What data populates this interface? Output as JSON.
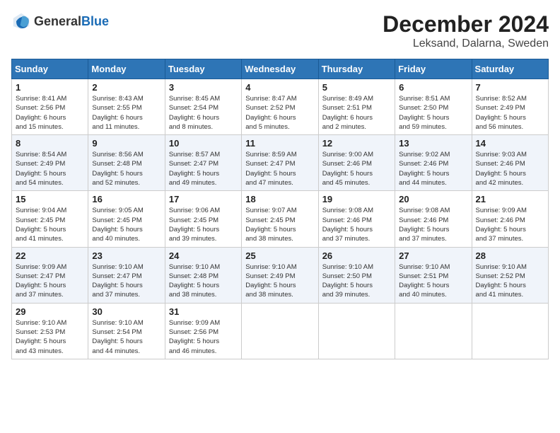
{
  "logo": {
    "general": "General",
    "blue": "Blue"
  },
  "header": {
    "month": "December 2024",
    "location": "Leksand, Dalarna, Sweden"
  },
  "weekdays": [
    "Sunday",
    "Monday",
    "Tuesday",
    "Wednesday",
    "Thursday",
    "Friday",
    "Saturday"
  ],
  "weeks": [
    [
      {
        "day": "1",
        "info": "Sunrise: 8:41 AM\nSunset: 2:56 PM\nDaylight: 6 hours\nand 15 minutes."
      },
      {
        "day": "2",
        "info": "Sunrise: 8:43 AM\nSunset: 2:55 PM\nDaylight: 6 hours\nand 11 minutes."
      },
      {
        "day": "3",
        "info": "Sunrise: 8:45 AM\nSunset: 2:54 PM\nDaylight: 6 hours\nand 8 minutes."
      },
      {
        "day": "4",
        "info": "Sunrise: 8:47 AM\nSunset: 2:52 PM\nDaylight: 6 hours\nand 5 minutes."
      },
      {
        "day": "5",
        "info": "Sunrise: 8:49 AM\nSunset: 2:51 PM\nDaylight: 6 hours\nand 2 minutes."
      },
      {
        "day": "6",
        "info": "Sunrise: 8:51 AM\nSunset: 2:50 PM\nDaylight: 5 hours\nand 59 minutes."
      },
      {
        "day": "7",
        "info": "Sunrise: 8:52 AM\nSunset: 2:49 PM\nDaylight: 5 hours\nand 56 minutes."
      }
    ],
    [
      {
        "day": "8",
        "info": "Sunrise: 8:54 AM\nSunset: 2:49 PM\nDaylight: 5 hours\nand 54 minutes."
      },
      {
        "day": "9",
        "info": "Sunrise: 8:56 AM\nSunset: 2:48 PM\nDaylight: 5 hours\nand 52 minutes."
      },
      {
        "day": "10",
        "info": "Sunrise: 8:57 AM\nSunset: 2:47 PM\nDaylight: 5 hours\nand 49 minutes."
      },
      {
        "day": "11",
        "info": "Sunrise: 8:59 AM\nSunset: 2:47 PM\nDaylight: 5 hours\nand 47 minutes."
      },
      {
        "day": "12",
        "info": "Sunrise: 9:00 AM\nSunset: 2:46 PM\nDaylight: 5 hours\nand 45 minutes."
      },
      {
        "day": "13",
        "info": "Sunrise: 9:02 AM\nSunset: 2:46 PM\nDaylight: 5 hours\nand 44 minutes."
      },
      {
        "day": "14",
        "info": "Sunrise: 9:03 AM\nSunset: 2:46 PM\nDaylight: 5 hours\nand 42 minutes."
      }
    ],
    [
      {
        "day": "15",
        "info": "Sunrise: 9:04 AM\nSunset: 2:45 PM\nDaylight: 5 hours\nand 41 minutes."
      },
      {
        "day": "16",
        "info": "Sunrise: 9:05 AM\nSunset: 2:45 PM\nDaylight: 5 hours\nand 40 minutes."
      },
      {
        "day": "17",
        "info": "Sunrise: 9:06 AM\nSunset: 2:45 PM\nDaylight: 5 hours\nand 39 minutes."
      },
      {
        "day": "18",
        "info": "Sunrise: 9:07 AM\nSunset: 2:45 PM\nDaylight: 5 hours\nand 38 minutes."
      },
      {
        "day": "19",
        "info": "Sunrise: 9:08 AM\nSunset: 2:46 PM\nDaylight: 5 hours\nand 37 minutes."
      },
      {
        "day": "20",
        "info": "Sunrise: 9:08 AM\nSunset: 2:46 PM\nDaylight: 5 hours\nand 37 minutes."
      },
      {
        "day": "21",
        "info": "Sunrise: 9:09 AM\nSunset: 2:46 PM\nDaylight: 5 hours\nand 37 minutes."
      }
    ],
    [
      {
        "day": "22",
        "info": "Sunrise: 9:09 AM\nSunset: 2:47 PM\nDaylight: 5 hours\nand 37 minutes."
      },
      {
        "day": "23",
        "info": "Sunrise: 9:10 AM\nSunset: 2:47 PM\nDaylight: 5 hours\nand 37 minutes."
      },
      {
        "day": "24",
        "info": "Sunrise: 9:10 AM\nSunset: 2:48 PM\nDaylight: 5 hours\nand 38 minutes."
      },
      {
        "day": "25",
        "info": "Sunrise: 9:10 AM\nSunset: 2:49 PM\nDaylight: 5 hours\nand 38 minutes."
      },
      {
        "day": "26",
        "info": "Sunrise: 9:10 AM\nSunset: 2:50 PM\nDaylight: 5 hours\nand 39 minutes."
      },
      {
        "day": "27",
        "info": "Sunrise: 9:10 AM\nSunset: 2:51 PM\nDaylight: 5 hours\nand 40 minutes."
      },
      {
        "day": "28",
        "info": "Sunrise: 9:10 AM\nSunset: 2:52 PM\nDaylight: 5 hours\nand 41 minutes."
      }
    ],
    [
      {
        "day": "29",
        "info": "Sunrise: 9:10 AM\nSunset: 2:53 PM\nDaylight: 5 hours\nand 43 minutes."
      },
      {
        "day": "30",
        "info": "Sunrise: 9:10 AM\nSunset: 2:54 PM\nDaylight: 5 hours\nand 44 minutes."
      },
      {
        "day": "31",
        "info": "Sunrise: 9:09 AM\nSunset: 2:56 PM\nDaylight: 5 hours\nand 46 minutes."
      },
      null,
      null,
      null,
      null
    ]
  ]
}
